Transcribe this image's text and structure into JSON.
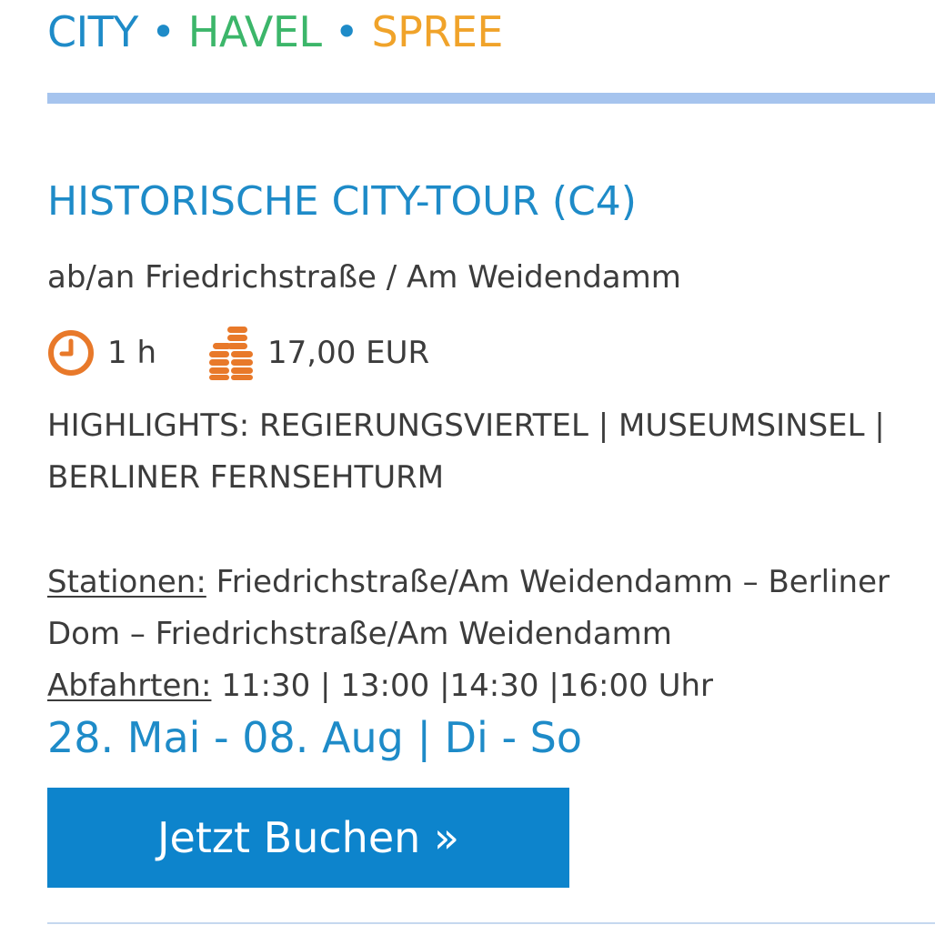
{
  "brand": {
    "city": "CITY",
    "separator_1": " • ",
    "havel": "HAVEL",
    "separator_2": " • ",
    "spree": "SPREE"
  },
  "tour": {
    "title": "HISTORISCHE CITY-TOUR (C4)",
    "departure_point": "ab/an Friedrichstraße / Am Weidendamm",
    "duration": "1 h",
    "price": "17,00 EUR",
    "highlights": "HIGHLIGHTS: REGIERUNGSVIERTEL | MUSEUMSINSEL | BERLINER FERNSEHTURM",
    "stations_label": "Stationen:",
    "stations_value": " Friedrichstraße/Am Weidendamm – Berliner Dom – Friedrichstraße/Am Weidendamm",
    "departures_label": "Abfahrten:",
    "departures_value": " 11:30 | 13:00 |14:30 |16:00 Uhr",
    "date_range": "28. Mai - 08. Aug | Di - So"
  },
  "actions": {
    "book_label": "Jetzt Buchen »"
  },
  "icons": {
    "duration": "clock-icon",
    "price": "coins-icon"
  },
  "colors": {
    "brand_blue": "#1e8bc8",
    "brand_green": "#3cb66a",
    "brand_orange": "#f0a32a",
    "icon_orange": "#e8792a",
    "button_blue": "#0d84cc",
    "rule_light_blue": "#a6c4ee"
  }
}
